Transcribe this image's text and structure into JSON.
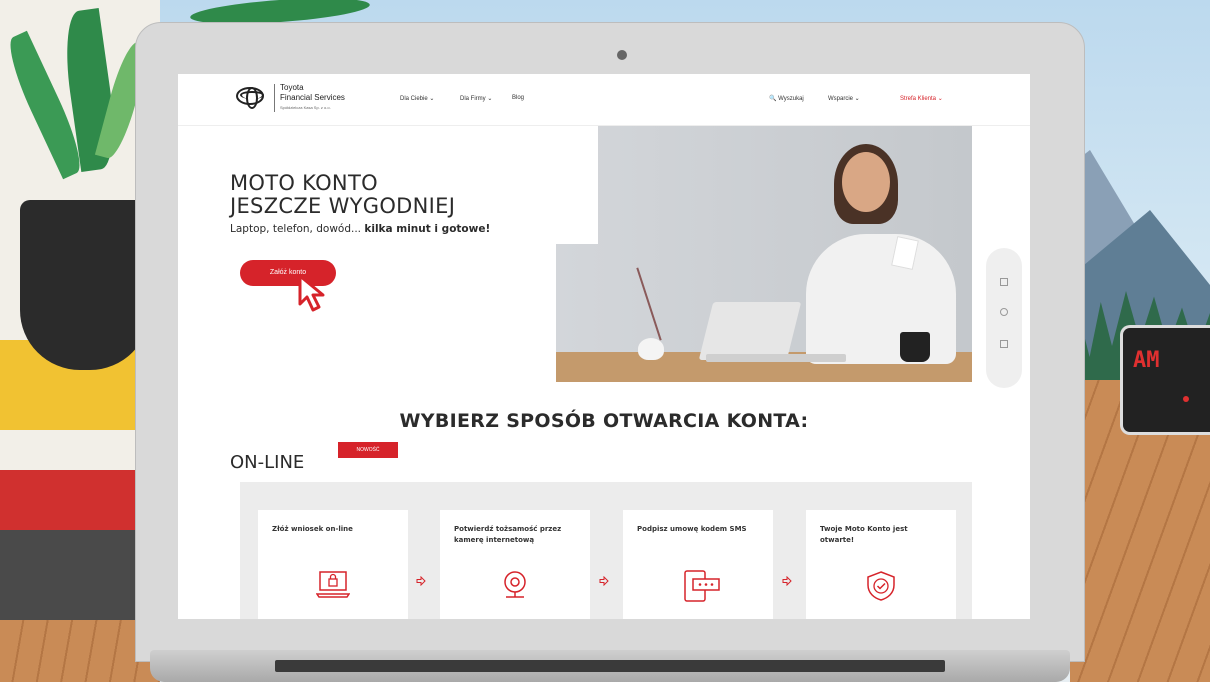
{
  "brand": {
    "line1": "Toyota",
    "line2": "Financial Services",
    "line3": "Spółdzielcza Kasa Sp. z o.o."
  },
  "nav": {
    "items": [
      "Dla Ciebie ⌄",
      "Dla Firmy ⌄",
      "Blog"
    ],
    "search_label": "🔍 Wyszukaj",
    "right_items": [
      "Wsparcie ⌄",
      "Strefa Klienta ⌄"
    ]
  },
  "hero": {
    "title_line1": "MOTO KONTO",
    "title_line2": "JESZCZE WYGODNIEJ",
    "subtitle_plain": "Laptop, telefon, dowód... ",
    "subtitle_bold": "kilka minut i gotowe!",
    "cta_label": "Załóż konto"
  },
  "section": {
    "title": "WYBIERZ SPOSÓB OTWARCIA KONTA:",
    "online_label": "ON-LINE",
    "badge": "NOWOŚĆ"
  },
  "steps": [
    {
      "text": "Złóż wniosek on-line",
      "icon": "laptop-lock-icon"
    },
    {
      "text": "Potwierdź tożsamość przez kamerę internetową",
      "icon": "webcam-icon"
    },
    {
      "text": "Podpisz umowę kodem SMS",
      "icon": "phone-sms-icon"
    },
    {
      "text": "Twoje Moto Konto jest otwarte!",
      "icon": "shield-check-icon"
    }
  ],
  "device": {
    "display": "AM"
  },
  "colors": {
    "accent": "#d6232a",
    "text": "#2b2b2b",
    "panel": "#ececec"
  }
}
